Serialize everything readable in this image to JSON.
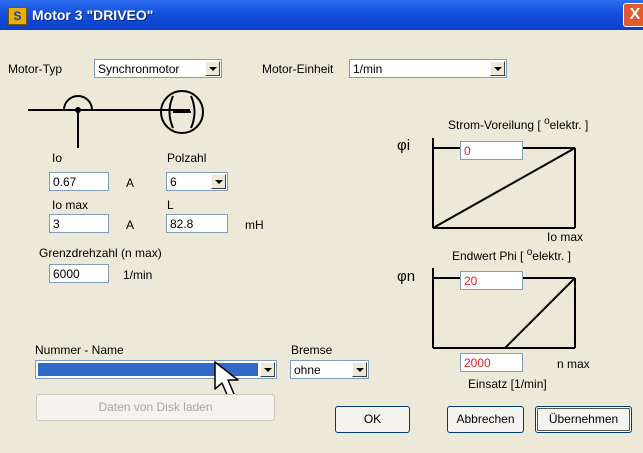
{
  "window": {
    "title": "Motor 3 \"DRIVEO\"",
    "app_icon": "S",
    "close": "X"
  },
  "motor_typ": {
    "label": "Motor-Typ",
    "value": "Synchronmotor"
  },
  "motor_einheit": {
    "label": "Motor-Einheit",
    "value": "1/min"
  },
  "io": {
    "label": "Io",
    "value": "0.67",
    "unit": "A"
  },
  "polzahl": {
    "label": "Polzahl",
    "value": "6"
  },
  "io_max": {
    "label": "Io max",
    "value": "3",
    "unit": "A"
  },
  "l": {
    "label": "L",
    "value": "82.8",
    "unit": "mH"
  },
  "grenzdrehzahl": {
    "label": "Grenzdrehzahl (n max)",
    "value": "6000",
    "unit": "1/min"
  },
  "strom_voreilung": {
    "label_pre": "Strom-Voreilung [",
    "sup": "o",
    "sub": "elektr. ]",
    "value": "0",
    "axis": "φi",
    "x_label": "Io max"
  },
  "endwert_phi": {
    "label_pre": "Endwert Phi [",
    "sup": "o",
    "sub": "elektr. ]",
    "value": "20",
    "axis": "φn",
    "x_label": "n max",
    "einsatz_value": "2000",
    "einsatz_label": "Einsatz [1/min]"
  },
  "nummer_name": {
    "label": "Nummer - Name",
    "value": ""
  },
  "bremse": {
    "label": "Bremse",
    "value": "ohne"
  },
  "buttons": {
    "load": "Daten von Disk laden",
    "ok": "OK",
    "cancel": "Abbrechen",
    "apply": "Übernehmen"
  }
}
